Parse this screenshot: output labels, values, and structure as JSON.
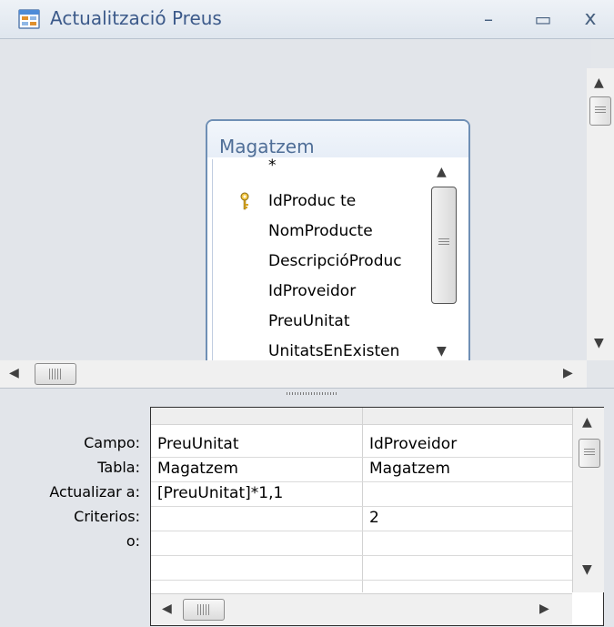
{
  "window": {
    "title": "Actualització Preus",
    "minimize_glyph": "–",
    "maximize_glyph": "▭",
    "close_glyph": "x",
    "icon": "query-window-icon"
  },
  "table_box": {
    "name": "Magatzem",
    "fields": [
      "*",
      "IdProduc te",
      "NomProducte",
      "DescripcióProduc",
      "IdProveidor",
      "PreuUnitat",
      "UnitatsEnExisten"
    ],
    "primary_key_field_index": 1,
    "key_icon": "key-icon"
  },
  "grid": {
    "row_labels": [
      "Campo:",
      "Tabla:",
      "Actualizar a:",
      "Criterios:",
      "o:"
    ],
    "columns": [
      {
        "campo": "PreuUnitat",
        "tabla": "Magatzem",
        "actualizar": "[PreuUnitat]*1,1",
        "criterios": "",
        "o": ""
      },
      {
        "campo": "IdProveidor",
        "tabla": "Magatzem",
        "actualizar": "",
        "criterios": "2",
        "o": ""
      }
    ]
  },
  "scroll_glyphs": {
    "up": "▲",
    "down": "▼",
    "left": "◀",
    "right": "▶"
  }
}
